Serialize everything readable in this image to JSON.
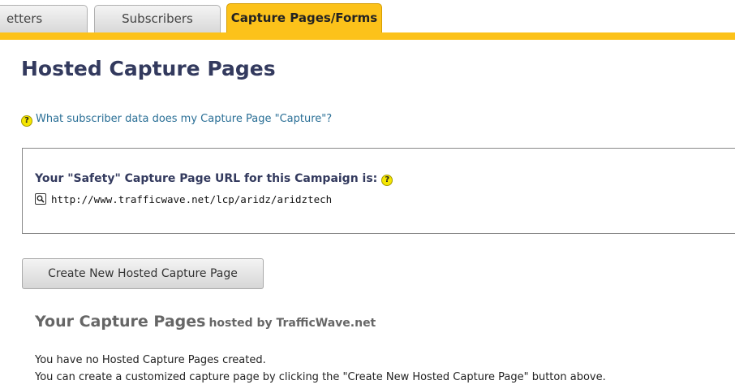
{
  "tabs": {
    "letters": "etters",
    "subscribers": "Subscribers",
    "capture": "Capture Pages/Forms"
  },
  "colors": {
    "accent": "#fcc21a",
    "title": "#333a5e",
    "link": "#2a6f96"
  },
  "page": {
    "title": "Hosted Capture Pages"
  },
  "help": {
    "link_text": "What subscriber data does my Capture Page \"Capture\"?"
  },
  "url_box": {
    "label": "Your \"Safety\" Capture Page URL for this Campaign is:",
    "url": "http://www.trafficwave.net/lcp/aridz/aridztech"
  },
  "actions": {
    "create_label": "Create New Hosted Capture Page"
  },
  "capture_pages": {
    "heading": "Your Capture Pages",
    "subheading": "hosted by TrafficWave.net",
    "empty_line1": "You have no Hosted Capture Pages created.",
    "empty_line2": "You can create a customized capture page by clicking the \"Create New Hosted Capture Page\" button above."
  },
  "icons": {
    "help": "help-icon",
    "magnify": "magnify-icon"
  },
  "help_glyph": "?"
}
